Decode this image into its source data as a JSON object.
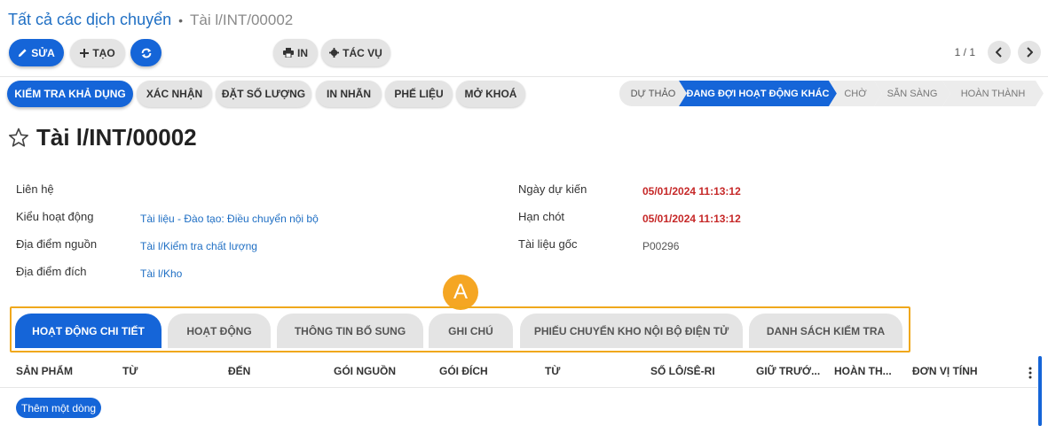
{
  "breadcrumb": {
    "parent": "Tất cả các dịch chuyển",
    "separator": "•",
    "current": "Tài l/INT/00002"
  },
  "toolbar": {
    "edit_label": "SỬA",
    "create_label": "TẠO",
    "print_label": "IN",
    "action_label": "TÁC VỤ",
    "pager": "1 / 1"
  },
  "actions": {
    "check_availability": "KIỂM TRA KHẢ DỤNG",
    "confirm": "XÁC NHẬN",
    "set_quantity": "ĐẶT SỐ LƯỢNG",
    "print_labels": "IN NHÃN",
    "scrap": "PHẾ LIỆU",
    "unlock": "MỞ KHOÁ"
  },
  "status_steps": [
    "DỰ THẢO",
    "ĐANG ĐỢI HOẠT ĐỘNG KHÁC",
    "CHỜ",
    "SẴN SÀNG",
    "HOÀN THÀNH"
  ],
  "record_title": "Tài l/INT/00002",
  "fields_left": [
    {
      "label": "Liên hệ",
      "value": ""
    },
    {
      "label": "Kiểu hoạt động",
      "value": "Tài liệu - Đào tạo: Điều chuyển nội bộ"
    },
    {
      "label": "Địa điểm nguồn",
      "value": "Tài l/Kiểm tra chất lượng"
    },
    {
      "label": "Địa điểm đích",
      "value": "Tài l/Kho"
    }
  ],
  "fields_right": [
    {
      "label": "Ngày dự kiến",
      "value": "05/01/2024 11:13:12"
    },
    {
      "label": "Hạn chót",
      "value": "05/01/2024 11:13:12"
    },
    {
      "label": "Tài liệu gốc",
      "value": "P00296"
    }
  ],
  "annotation": "A",
  "tabs": [
    "HOẠT ĐỘNG CHI TIẾT",
    "HOẠT ĐỘNG",
    "THÔNG TIN BỔ SUNG",
    "GHI CHÚ",
    "PHIẾU CHUYỂN KHO NỘI BỘ ĐIỆN TỬ",
    "DANH SÁCH KIỂM TRA"
  ],
  "table_headers": [
    "SẢN PHẨM",
    "TỪ",
    "ĐẾN",
    "GÓI NGUỒN",
    "GÓI ĐÍCH",
    "TỪ",
    "SỐ LÔ/SÊ-RI",
    "GIỮ TRƯỚ...",
    "HOÀN TH...",
    "ĐƠN VỊ TÍNH"
  ],
  "add_line_label": "Thêm một dòng",
  "colors": {
    "primary": "#1565d8",
    "link": "#1f6fc4",
    "danger": "#c62828",
    "annotation": "#f5a623"
  }
}
